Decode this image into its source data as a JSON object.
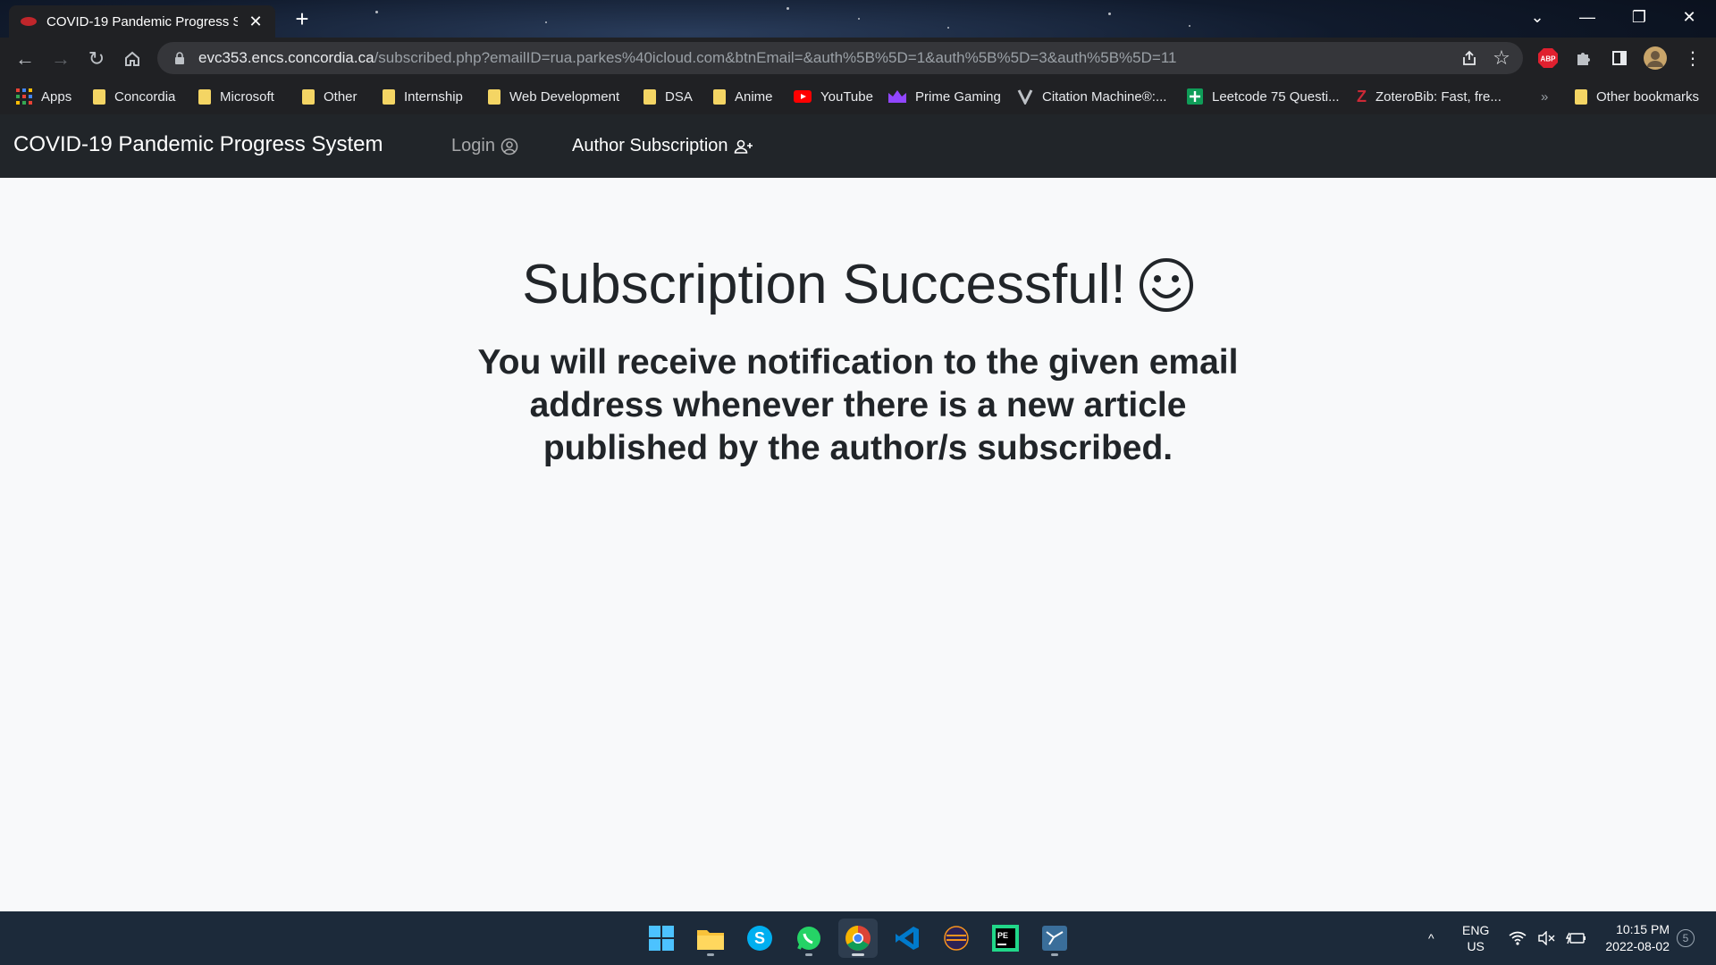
{
  "browser": {
    "tab_title": "COVID-19 Pandemic Progress Sy",
    "new_tab": "+",
    "url_host": "evc353.encs.concordia.ca",
    "url_path": "/subscribed.php?emailID=rua.parkes%40icloud.com&btnEmail=&auth%5B%5D=1&auth%5B%5D=3&auth%5B%5D=11",
    "bookmarks": [
      {
        "label": "Apps",
        "icon": "apps-grid-icon"
      },
      {
        "label": "Concordia",
        "icon": "folder-icon"
      },
      {
        "label": "Microsoft",
        "icon": "folder-icon"
      },
      {
        "label": "Other",
        "icon": "folder-icon"
      },
      {
        "label": "Internship",
        "icon": "folder-icon"
      },
      {
        "label": "Web Development",
        "icon": "folder-icon"
      },
      {
        "label": "DSA",
        "icon": "folder-icon"
      },
      {
        "label": "Anime",
        "icon": "folder-icon"
      },
      {
        "label": "YouTube",
        "icon": "youtube-icon"
      },
      {
        "label": "Prime Gaming",
        "icon": "crown-icon"
      },
      {
        "label": "Citation Machine®:...",
        "icon": "citation-icon"
      },
      {
        "label": "Leetcode 75 Questi...",
        "icon": "sheets-icon"
      },
      {
        "label": "ZoteroBib: Fast, fre...",
        "icon": "zotero-icon"
      }
    ],
    "bookmarks_overflow": "»",
    "other_bookmarks": "Other bookmarks",
    "extension_abp": "ABP"
  },
  "site": {
    "brand": "COVID-19 Pandemic Progress System",
    "nav": {
      "login": "Login",
      "author_subscription": "Author Subscription"
    },
    "heading": "Subscription Successful!",
    "message": "You will receive notification to the given email address whenever there is a new article published by the author/s subscribed."
  },
  "taskbar": {
    "apps": [
      "start-icon",
      "file-explorer-icon",
      "skype-icon",
      "whatsapp-icon",
      "chrome-icon",
      "vscode-icon",
      "eclipse-icon",
      "pycharm-icon",
      "mysql-workbench-icon"
    ],
    "language": "ENG",
    "region": "US",
    "time": "10:15 PM",
    "date": "2022-08-02",
    "notification_count": "5"
  },
  "colors": {
    "navbar_bg": "#212529",
    "page_bg": "#f8f9fa",
    "taskbar_bg": "#1c2a3a",
    "abp_red": "#e0202f"
  }
}
